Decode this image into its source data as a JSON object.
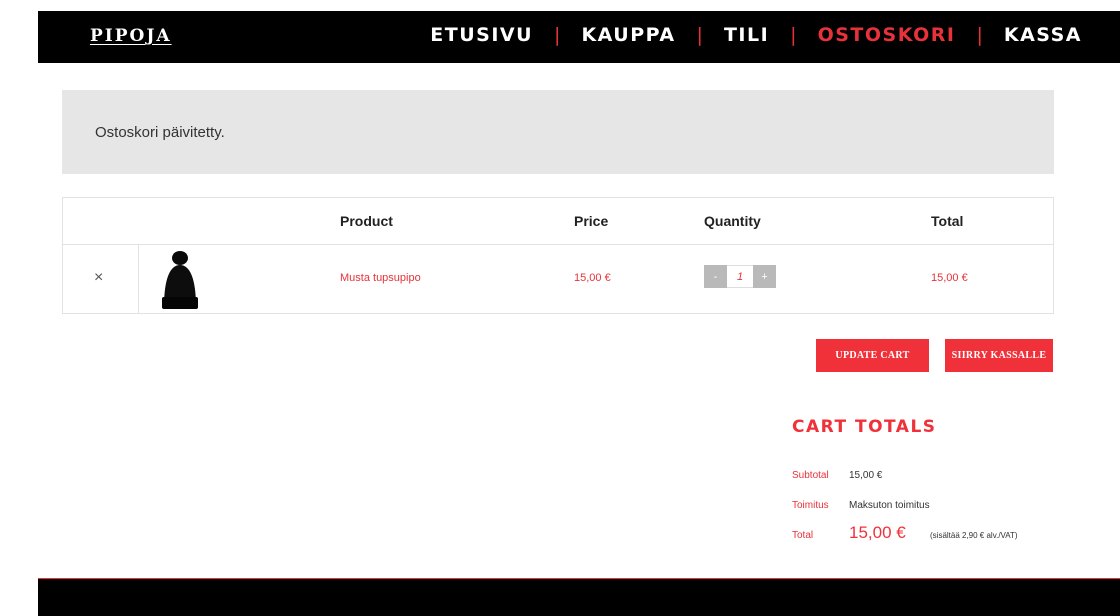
{
  "header": {
    "logo": "PIPOJA",
    "nav": [
      {
        "label": "ETUSIVU",
        "active": false
      },
      {
        "label": "KAUPPA",
        "active": false
      },
      {
        "label": "TILI",
        "active": false
      },
      {
        "label": "OSTOSKORI",
        "active": true
      },
      {
        "label": "KASSA",
        "active": false
      }
    ],
    "separator": "|"
  },
  "notice": {
    "text": "Ostoskori päivitetty."
  },
  "cart": {
    "columns": {
      "product": "Product",
      "price": "Price",
      "quantity": "Quantity",
      "total": "Total"
    },
    "items": [
      {
        "remove_symbol": "×",
        "thumbnail_icon": "black-beanie-icon",
        "name": "Musta tupsupipo",
        "price": "15,00 €",
        "quantity": "1",
        "total": "15,00 €"
      }
    ],
    "qty_minus": "-",
    "qty_plus": "+"
  },
  "actions": {
    "update": "UPDATE CART",
    "checkout": "SIIRRY KASSALLE"
  },
  "totals": {
    "title": "CART TOTALS",
    "subtotal_label": "Subtotal",
    "subtotal_value": "15,00 €",
    "shipping_label": "Toimitus",
    "shipping_value": "Maksuton toimitus",
    "total_label": "Total",
    "total_value": "15,00 €",
    "vat_note": "(sisältää 2,90 € alv./VAT)"
  },
  "colors": {
    "accent": "#f0313a",
    "header_bg": "#000000",
    "notice_bg": "#e6e6e6"
  }
}
